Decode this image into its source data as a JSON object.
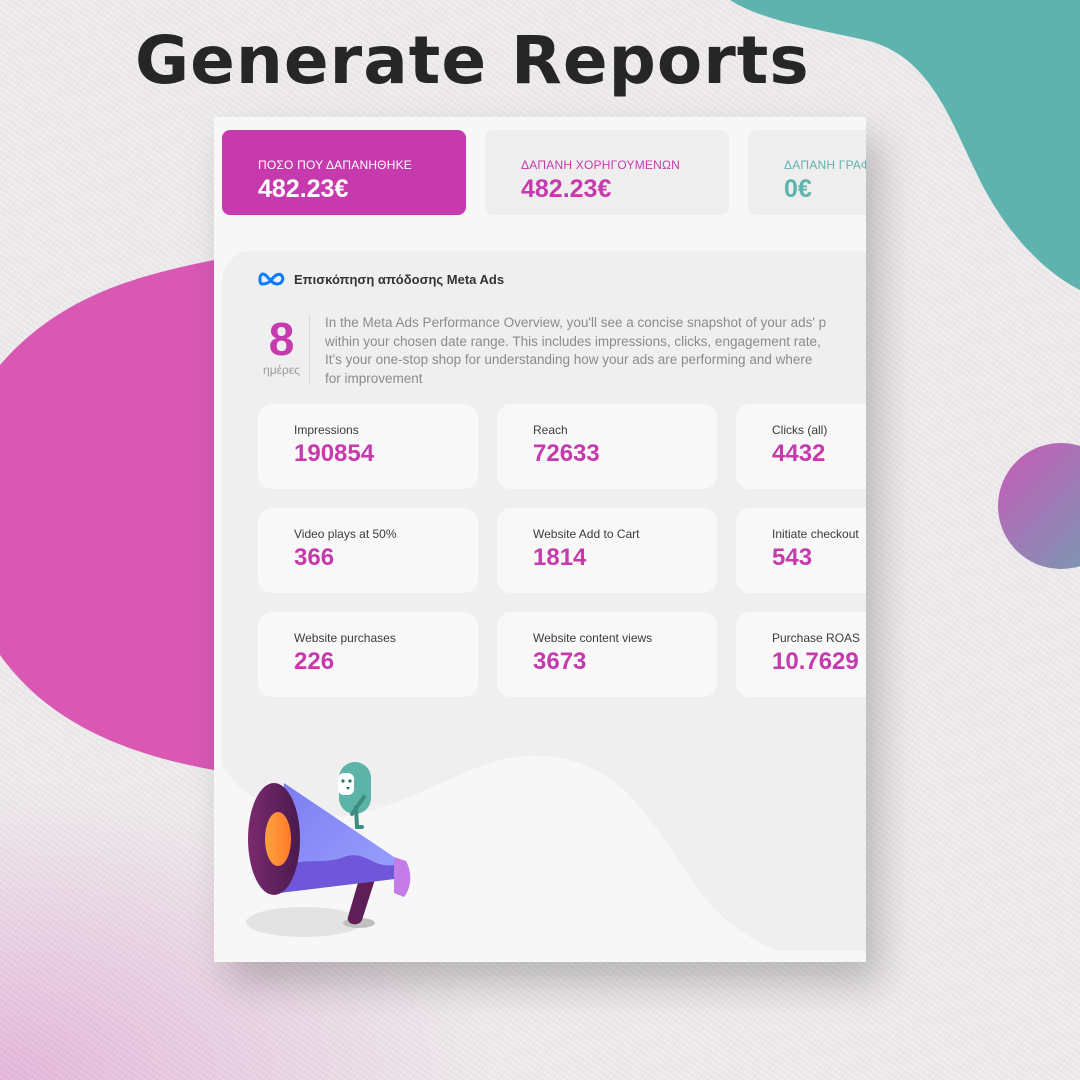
{
  "headline": "Generate Reports",
  "colors": {
    "brand_magenta": "#c63aae",
    "teal": "#5fb3ae",
    "pink_blob": "#d858b4",
    "text_dark": "#262626"
  },
  "kpis": [
    {
      "label": "ΠΟΣΟ ΠΟΥ ΔΑΠΑΝΗΘΗΚΕ",
      "value": "482.23€",
      "style": "primary"
    },
    {
      "label": "ΔΑΠΑΝΗ ΧΟΡΗΓΟΥΜΕΝΩΝ",
      "value": "482.23€",
      "style": "magenta"
    },
    {
      "label": "ΔΑΠΑΝΗ ΓΡΑΦ",
      "value": "0€",
      "style": "teal"
    }
  ],
  "overview": {
    "icon": "meta-logo-icon",
    "title": "Επισκόπηση απόδοσης Meta Ads",
    "days_value": "8",
    "days_label": "ημέρες",
    "description_lines": [
      "In the Meta Ads Performance Overview, you'll see a concise snapshot of your ads' p",
      "within your chosen date range. This includes impressions, clicks, engagement rate,",
      "It's your one-stop shop for understanding how your ads are performing and where",
      "for improvement"
    ]
  },
  "metrics": [
    {
      "label": "Impressions",
      "value": "190854"
    },
    {
      "label": "Reach",
      "value": "72633"
    },
    {
      "label": "Clicks (all)",
      "value": "4432"
    },
    {
      "label": "Video plays at 50%",
      "value": "366"
    },
    {
      "label": "Website Add to Cart",
      "value": "1814"
    },
    {
      "label": "Initiate checkout",
      "value": "543"
    },
    {
      "label": "Website purchases",
      "value": "226"
    },
    {
      "label": "Website content views",
      "value": "3673"
    },
    {
      "label": "Purchase ROAS",
      "value": "10.7629"
    }
  ],
  "illustration": "megaphone-character-icon"
}
